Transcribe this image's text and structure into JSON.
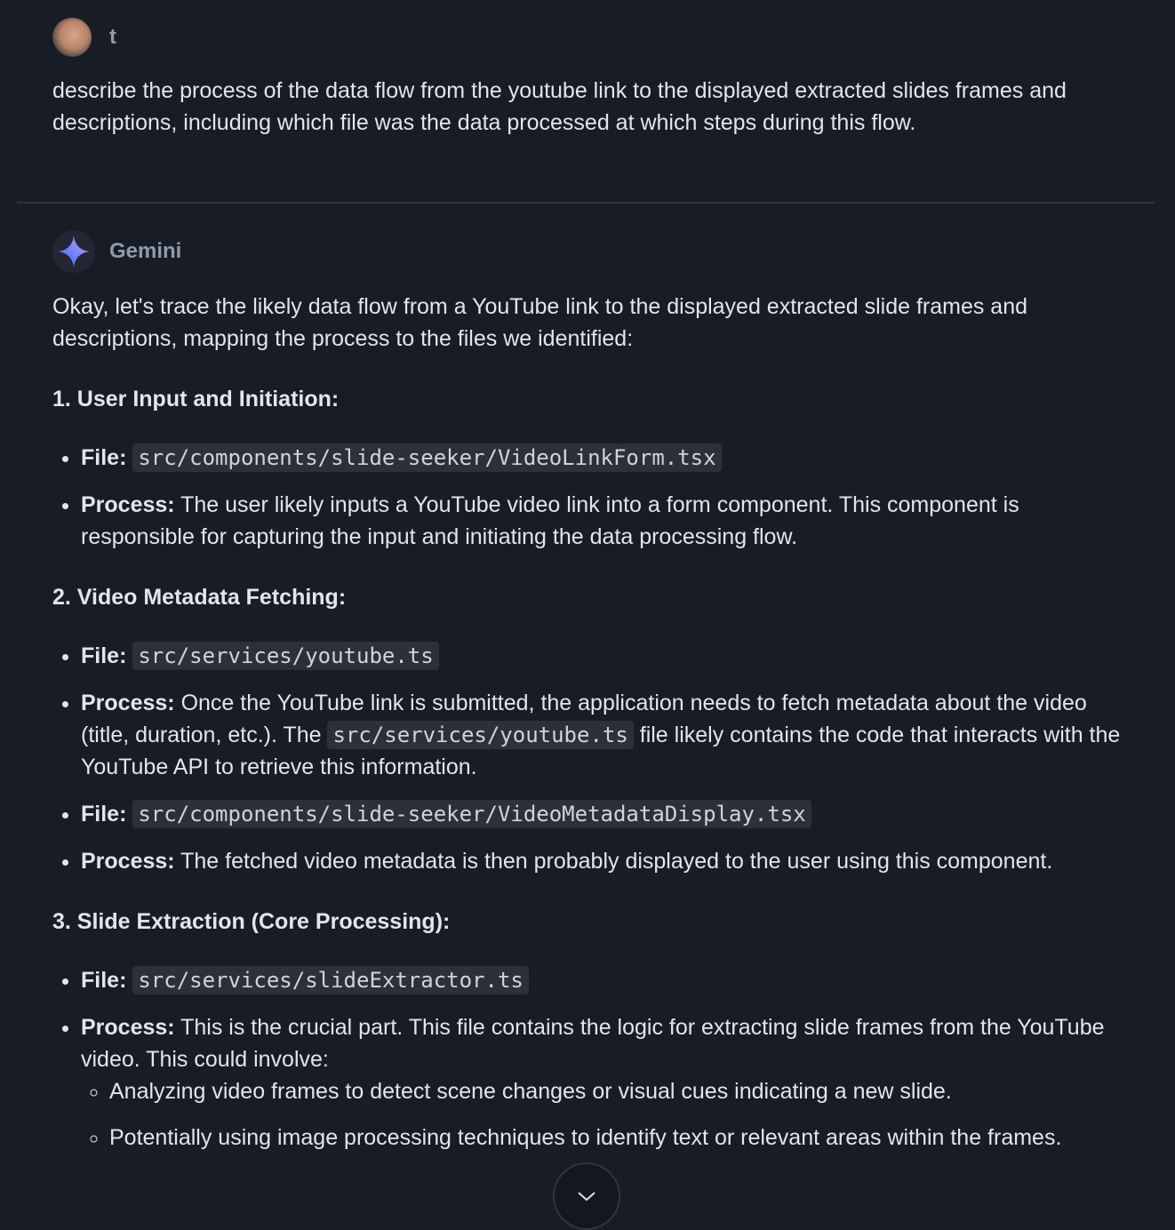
{
  "user": {
    "name": "t",
    "message": "describe the process of the data flow from the youtube link to the displayed extracted slides frames and descriptions, including which file was the data processed at which steps during this flow."
  },
  "assistant": {
    "name": "Gemini",
    "intro": "Okay, let's trace the likely data flow from a YouTube link to the displayed extracted slide frames and descriptions, mapping the process to the files we identified:",
    "file_label": "File:",
    "process_label": "Process:",
    "sections": [
      {
        "title": "1. User Input and Initiation:",
        "file1": "src/components/slide-seeker/VideoLinkForm.tsx",
        "process1": "The user likely inputs a YouTube video link into a form component. This component is responsible for capturing the input and initiating the data processing flow."
      },
      {
        "title": "2. Video Metadata Fetching:",
        "file1": "src/services/youtube.ts",
        "process1_a": "Once the YouTube link is submitted, the application needs to fetch metadata about the video (title, duration, etc.). The",
        "process1_code": "src/services/youtube.ts",
        "process1_b": "file likely contains the code that interacts with the YouTube API to retrieve this information.",
        "file2": "src/components/slide-seeker/VideoMetadataDisplay.tsx",
        "process2": "The fetched video metadata is then probably displayed to the user using this component."
      },
      {
        "title": "3. Slide Extraction (Core Processing):",
        "file1": "src/services/slideExtractor.ts",
        "process1": "This is the crucial part. This file contains the logic for extracting slide frames from the YouTube video. This could involve:",
        "sub": [
          "Analyzing video frames to detect scene changes or visual cues indicating a new slide.",
          "Potentially using image processing techniques to identify text or relevant areas within the frames."
        ]
      }
    ]
  },
  "icons": {
    "scroll": "chevron-down-icon",
    "gemini": "sparkle-icon"
  }
}
